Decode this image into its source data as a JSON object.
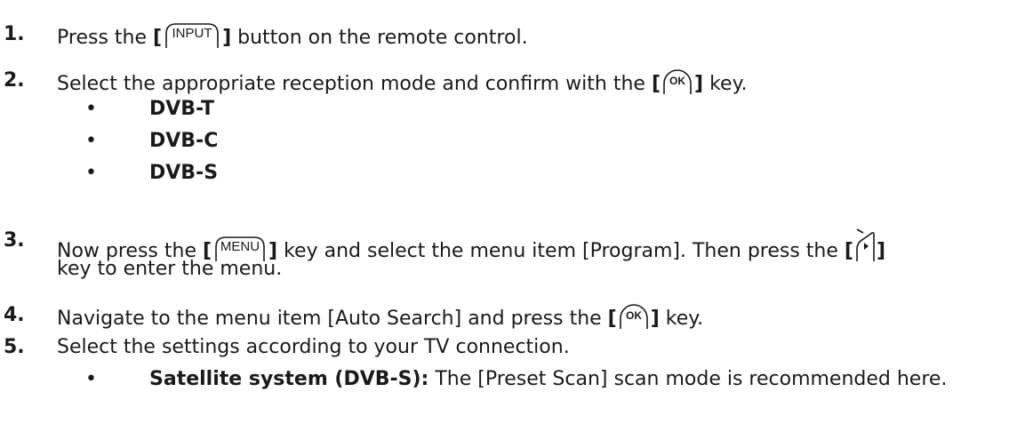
{
  "steps": [
    {
      "number": "1.",
      "before": "Press the ",
      "key": "INPUT",
      "after": " button on the remote control."
    },
    {
      "number": "2.",
      "before": "Select the appropriate reception mode and confirm with the ",
      "key": "OK",
      "after": " key."
    },
    {
      "number": "3.",
      "before": "Now press the ",
      "key": "MENU",
      "middle": " key and select the menu item [Program]. Then press the ",
      "key2": "right-arrow",
      "line2": "key to enter the menu."
    },
    {
      "number": "4.",
      "before": "Navigate to the menu item [Auto Search] and press the ",
      "key": "OK",
      "after": " key."
    },
    {
      "number": "5.",
      "before": "Select the settings according to your TV connection."
    }
  ],
  "modes": [
    "DVB-T",
    "DVB-C",
    "DVB-S"
  ],
  "bullet_char": "•",
  "satellite": {
    "label": "Satellite system (DVB-S):",
    "text": " The [Preset Scan] scan mode is recommended here."
  },
  "bracket_open": "[",
  "bracket_close": "]"
}
